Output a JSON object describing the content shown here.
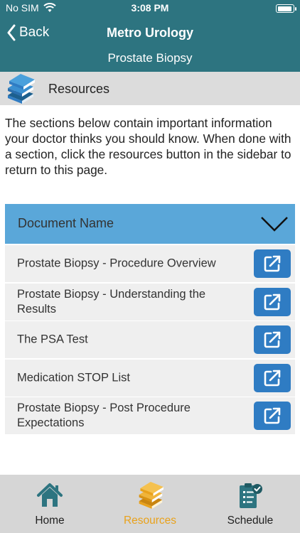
{
  "status_bar": {
    "carrier": "No SIM",
    "time": "3:08 PM"
  },
  "nav": {
    "back_label": "Back",
    "title": "Metro Urology",
    "subtitle": "Prostate Biopsy"
  },
  "section": {
    "title": "Resources",
    "icon": "books-icon"
  },
  "intro": "The sections below contain important information your doctor thinks you should know. When done with a section, click the resources button in the sidebar to return to this page.",
  "documents": {
    "header_label": "Document Name",
    "items": [
      {
        "label": "Prostate Biopsy - Procedure Overview"
      },
      {
        "label": "Prostate Biopsy - Understanding the Results"
      },
      {
        "label": "The PSA Test"
      },
      {
        "label": "Medication STOP List"
      },
      {
        "label": "Prostate Biopsy - Post Procedure Expectations"
      }
    ]
  },
  "tabs": [
    {
      "label": "Home",
      "icon": "home-icon"
    },
    {
      "label": "Resources",
      "icon": "books-icon",
      "active": true
    },
    {
      "label": "Schedule",
      "icon": "schedule-icon"
    }
  ],
  "colors": {
    "header": "#2d7480",
    "accent": "#5aa7d9",
    "button": "#2f7cc3",
    "active_tab": "#e9a21c"
  }
}
